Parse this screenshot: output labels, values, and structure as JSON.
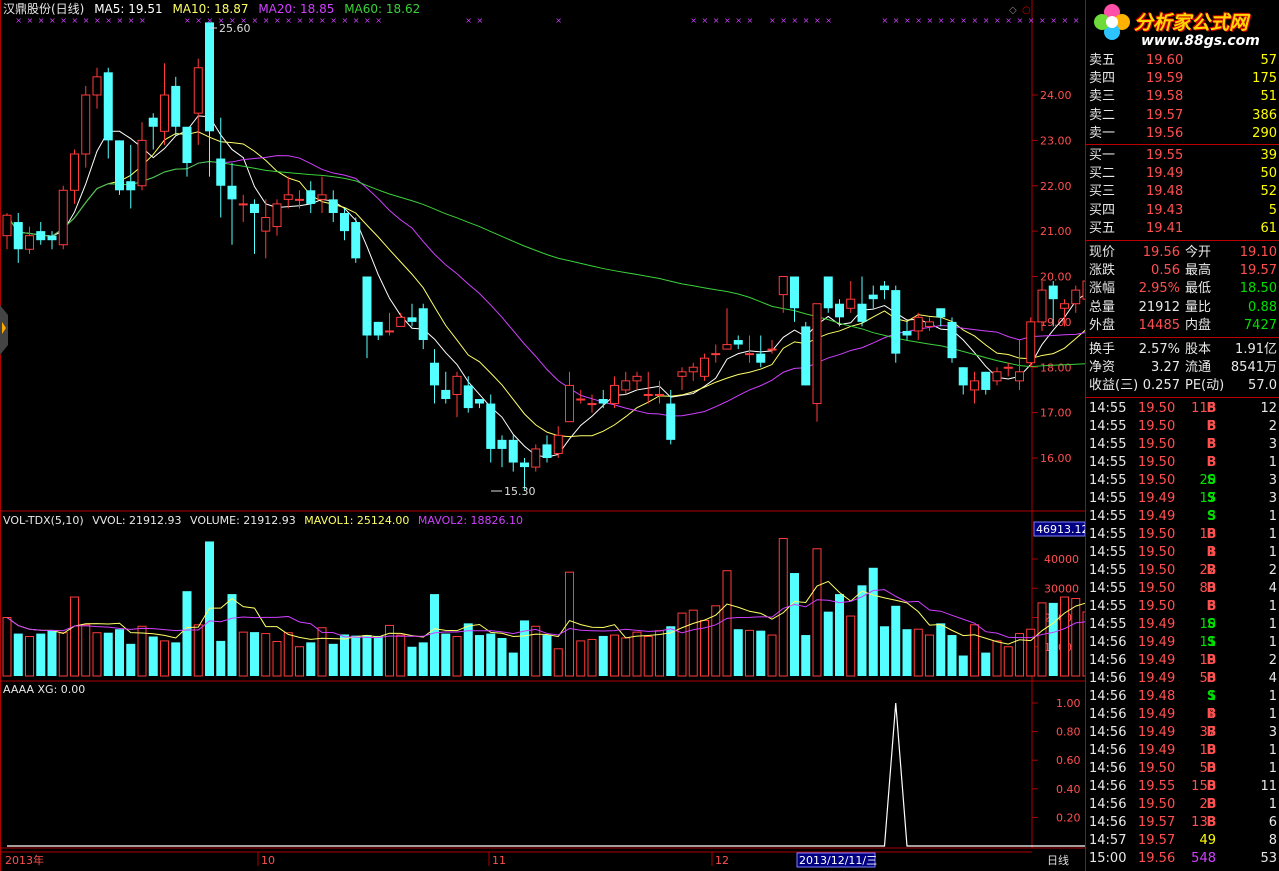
{
  "header": {
    "title": "汉鼎股份(日线)",
    "ma5": "MA5: 19.51",
    "ma10": "MA10: 18.87",
    "ma20": "MA20: 18.85",
    "ma60": "MA60: 18.62",
    "high_label": "25.60",
    "low_label": "15.30"
  },
  "vol_header": {
    "name": "VOL-TDX(5,10)",
    "vvol": "VVOL: 21912.93",
    "volume": "VOLUME: 21912.93",
    "mavol1": "MAVOL1: 25124.00",
    "mavol2": "MAVOL2: 18826.10",
    "max_box": "46913.12"
  },
  "ind_header": {
    "text": "AAAA XG: 0.00"
  },
  "axis": {
    "price_ticks": [
      "24.00",
      "23.00",
      "22.00",
      "21.00",
      "20.00",
      "19.00",
      "18.00",
      "17.00",
      "16.00"
    ],
    "vol_ticks": [
      "40000",
      "30000",
      "20000",
      "10000"
    ],
    "ind_ticks": [
      "1.00",
      "0.80",
      "0.60",
      "0.40",
      "0.20"
    ],
    "date_labels": [
      "2013年",
      "10",
      "11",
      "12"
    ],
    "cursor_date": "2013/12/11/三",
    "period": "日线"
  },
  "colors": {
    "up": "#ff3b3b",
    "down": "#54ffff",
    "ma5": "#ffffff",
    "ma10": "#ffff66",
    "ma20": "#d040ff",
    "ma60": "#3bd13b",
    "frame": "#b00000"
  },
  "chart_data": [
    {
      "type": "candlestick",
      "title": "汉鼎股份(日线)",
      "ylim": [
        15.0,
        25.8
      ],
      "candles": [
        [
          20.9,
          21.35,
          21.4,
          20.6
        ],
        [
          21.2,
          20.6,
          21.4,
          20.3
        ],
        [
          20.6,
          20.9,
          21.1,
          20.5
        ],
        [
          21.0,
          20.8,
          21.2,
          20.7
        ],
        [
          20.9,
          20.8,
          21.0,
          20.6
        ],
        [
          20.7,
          21.9,
          22.0,
          20.6
        ],
        [
          21.9,
          22.7,
          22.8,
          21.6
        ],
        [
          22.7,
          24.0,
          24.2,
          22.4
        ],
        [
          24.0,
          24.4,
          24.6,
          23.7
        ],
        [
          24.5,
          23.0,
          24.6,
          22.6
        ],
        [
          23.0,
          21.9,
          23.0,
          21.8
        ],
        [
          22.1,
          21.9,
          22.9,
          21.5
        ],
        [
          22.0,
          23.0,
          23.4,
          21.9
        ],
        [
          23.5,
          23.3,
          23.6,
          22.8
        ],
        [
          23.2,
          24.0,
          24.7,
          22.9
        ],
        [
          24.2,
          23.3,
          24.4,
          23.1
        ],
        [
          23.3,
          22.5,
          23.2,
          22.2
        ],
        [
          23.6,
          24.6,
          24.8,
          22.9
        ],
        [
          25.6,
          23.2,
          25.6,
          22.2
        ],
        [
          22.6,
          22.0,
          23.5,
          21.3
        ],
        [
          22.0,
          21.7,
          22.5,
          20.7
        ],
        [
          21.6,
          21.6,
          21.8,
          21.2
        ],
        [
          21.6,
          21.4,
          21.7,
          20.5
        ],
        [
          21.0,
          21.3,
          21.7,
          20.4
        ],
        [
          21.1,
          21.6,
          21.7,
          20.9
        ],
        [
          21.7,
          21.8,
          22.2,
          21.5
        ],
        [
          21.7,
          21.7,
          21.9,
          21.5
        ],
        [
          21.9,
          21.6,
          22.1,
          21.4
        ],
        [
          21.7,
          21.8,
          22.2,
          21.4
        ],
        [
          21.7,
          21.4,
          21.9,
          21.2
        ],
        [
          21.4,
          21.0,
          21.5,
          20.8
        ],
        [
          21.2,
          20.4,
          21.3,
          20.3
        ],
        [
          20.0,
          18.7,
          20.0,
          18.2
        ],
        [
          19.0,
          18.7,
          19.0,
          18.6
        ],
        [
          18.8,
          18.8,
          19.2,
          18.7
        ],
        [
          18.9,
          19.1,
          19.2,
          18.9
        ],
        [
          19.1,
          19.0,
          19.4,
          18.9
        ],
        [
          19.3,
          18.6,
          19.4,
          18.4
        ],
        [
          18.1,
          17.6,
          18.4,
          17.2
        ],
        [
          17.5,
          17.3,
          17.9,
          17.2
        ],
        [
          17.4,
          17.8,
          17.9,
          16.9
        ],
        [
          17.6,
          17.1,
          17.8,
          17.0
        ],
        [
          17.3,
          17.2,
          17.3,
          17.1
        ],
        [
          17.2,
          16.2,
          17.4,
          15.9
        ],
        [
          16.4,
          16.2,
          16.5,
          15.8
        ],
        [
          16.4,
          15.9,
          16.5,
          15.7
        ],
        [
          15.9,
          15.8,
          16.0,
          15.3
        ],
        [
          15.8,
          16.2,
          16.3,
          15.7
        ],
        [
          16.3,
          16.0,
          16.5,
          15.9
        ],
        [
          16.1,
          16.5,
          16.7,
          16.0
        ],
        [
          16.8,
          17.6,
          17.9,
          16.9
        ],
        [
          17.3,
          17.3,
          17.5,
          17.2
        ],
        [
          17.2,
          17.2,
          17.4,
          17.0
        ],
        [
          17.3,
          17.2,
          17.5,
          17.1
        ],
        [
          17.2,
          17.6,
          17.8,
          17.1
        ],
        [
          17.5,
          17.7,
          17.9,
          17.4
        ],
        [
          17.7,
          17.8,
          17.9,
          17.5
        ],
        [
          17.4,
          17.4,
          17.9,
          17.2
        ],
        [
          17.4,
          17.4,
          17.7,
          17.2
        ],
        [
          17.2,
          16.4,
          17.5,
          16.3
        ],
        [
          17.8,
          17.9,
          18.0,
          17.5
        ],
        [
          17.9,
          18.0,
          18.1,
          17.7
        ],
        [
          17.8,
          18.2,
          18.3,
          17.7
        ],
        [
          18.3,
          18.3,
          18.5,
          18.1
        ],
        [
          18.4,
          18.5,
          19.3,
          18.4
        ],
        [
          18.6,
          18.5,
          18.7,
          18.4
        ],
        [
          18.3,
          18.3,
          18.7,
          18.1
        ],
        [
          18.3,
          18.1,
          18.7,
          18.0
        ],
        [
          18.4,
          18.4,
          18.6,
          18.3
        ],
        [
          19.6,
          20.0,
          20.0,
          19.2
        ],
        [
          20.0,
          19.3,
          20.0,
          19.0
        ],
        [
          18.9,
          17.6,
          19.0,
          17.6
        ],
        [
          17.2,
          19.4,
          19.4,
          16.8
        ],
        [
          20.0,
          19.3,
          20.0,
          19.2
        ],
        [
          19.4,
          19.1,
          19.5,
          18.9
        ],
        [
          19.3,
          19.5,
          19.9,
          19.2
        ],
        [
          19.4,
          19.0,
          20.0,
          18.9
        ],
        [
          19.6,
          19.5,
          19.8,
          19.3
        ],
        [
          19.8,
          19.7,
          19.9,
          19.5
        ],
        [
          19.7,
          18.3,
          19.8,
          18.1
        ],
        [
          18.8,
          18.7,
          19.0,
          18.6
        ],
        [
          18.8,
          19.1,
          19.2,
          18.6
        ],
        [
          18.9,
          19.0,
          19.1,
          18.8
        ],
        [
          19.3,
          19.1,
          19.3,
          18.9
        ],
        [
          19.0,
          18.2,
          19.1,
          18.1
        ],
        [
          18.0,
          17.6,
          18.0,
          17.4
        ],
        [
          17.5,
          17.7,
          17.9,
          17.2
        ],
        [
          17.9,
          17.5,
          17.9,
          17.4
        ],
        [
          17.7,
          17.9,
          18.0,
          17.6
        ],
        [
          18.0,
          18.0,
          18.1,
          17.8
        ],
        [
          17.7,
          17.9,
          18.6,
          17.5
        ],
        [
          18.1,
          19.0,
          19.1,
          18.0
        ],
        [
          19.0,
          19.7,
          19.9,
          18.8
        ],
        [
          19.8,
          19.5,
          19.9,
          18.9
        ],
        [
          19.3,
          19.4,
          19.5,
          18.9
        ],
        [
          19.4,
          19.7,
          19.8,
          19.2
        ],
        [
          19.5,
          19.9,
          20.1,
          19.2
        ],
        [
          20.0,
          19.0,
          20.1,
          18.9
        ],
        [
          18.9,
          19.56,
          19.6,
          18.5
        ]
      ],
      "ma_lines": {
        "ma5": "MA5: 19.51",
        "ma10": "MA10: 18.87",
        "ma20": "MA20: 18.85",
        "ma60": "MA60: 18.62"
      }
    },
    {
      "type": "bar",
      "title": "VOL-TDX(5,10)",
      "ylim": [
        0,
        50000
      ],
      "volumes": [
        20000,
        14500,
        13500,
        14500,
        15500,
        14800,
        27000,
        17500,
        14800,
        14800,
        16000,
        11000,
        17000,
        13500,
        12000,
        11500,
        29000,
        17500,
        46000,
        12000,
        28000,
        15000,
        15000,
        14500,
        11800,
        14800,
        10000,
        11500,
        16500,
        11000,
        14200,
        13800,
        14000,
        13700,
        17300,
        14000,
        10000,
        11500,
        28000,
        14500,
        13500,
        18000,
        14000,
        14500,
        13000,
        8000,
        19000,
        17000,
        14000,
        9300,
        35500,
        12000,
        12500,
        13700,
        14000,
        13000,
        15000,
        13500,
        15500,
        17000,
        21500,
        22500,
        19000,
        24000,
        36000,
        16000,
        15600,
        15500,
        14000,
        47000,
        35200,
        14000,
        43500,
        22000,
        28000,
        20500,
        31000,
        37000,
        17000,
        24000,
        16000,
        16000,
        14000,
        18000,
        14000,
        7000,
        17500,
        8000,
        12000,
        10000,
        14500,
        16000,
        25000,
        25000,
        27000,
        26500,
        21913
      ],
      "mavol1": "MAVOL1: 25124.00",
      "mavol2": "MAVOL2: 18826.10"
    },
    {
      "type": "line",
      "title": "AAAA XG",
      "ylim": [
        0,
        1.1
      ],
      "spike_index": 79,
      "value": "AAAA XG: 0.00"
    }
  ],
  "quote": {
    "sell": [
      {
        "label": "卖五",
        "price": "19.60",
        "vol": "57"
      },
      {
        "label": "卖四",
        "price": "19.59",
        "vol": "175"
      },
      {
        "label": "卖三",
        "price": "19.58",
        "vol": "51"
      },
      {
        "label": "卖二",
        "price": "19.57",
        "vol": "386"
      },
      {
        "label": "卖一",
        "price": "19.56",
        "vol": "290"
      }
    ],
    "buy": [
      {
        "label": "买一",
        "price": "19.55",
        "vol": "39"
      },
      {
        "label": "买二",
        "price": "19.49",
        "vol": "50"
      },
      {
        "label": "买三",
        "price": "19.48",
        "vol": "52"
      },
      {
        "label": "买四",
        "price": "19.43",
        "vol": "5"
      },
      {
        "label": "买五",
        "price": "19.41",
        "vol": "61"
      }
    ],
    "stats": [
      {
        "l1": "现价",
        "v1": "19.56",
        "c1": "c-red",
        "l2": "今开",
        "v2": "19.10",
        "c2": "c-red"
      },
      {
        "l1": "涨跌",
        "v1": "0.56",
        "c1": "c-red",
        "l2": "最高",
        "v2": "19.57",
        "c2": "c-red"
      },
      {
        "l1": "涨幅",
        "v1": "2.95%",
        "c1": "c-red",
        "l2": "最低",
        "v2": "18.50",
        "c2": "c-grn"
      },
      {
        "l1": "总量",
        "v1": "21912",
        "c1": "c-wht",
        "l2": "量比",
        "v2": "0.88",
        "c2": "c-grn"
      },
      {
        "l1": "外盘",
        "v1": "14485",
        "c1": "c-red",
        "l2": "内盘",
        "v2": "7427",
        "c2": "c-grn"
      }
    ],
    "stats2": [
      {
        "l1": "换手",
        "v1": "2.57%",
        "l2": "股本",
        "v2": "1.91亿"
      },
      {
        "l1": "净资",
        "v1": "3.27",
        "l2": "流通",
        "v2": "8541万"
      },
      {
        "l1": "收益(三)",
        "v1": "0.257",
        "l2": "PE(动)",
        "v2": "57.0"
      }
    ]
  },
  "trades": [
    [
      "14:55",
      "19.50",
      "115",
      "B",
      "12"
    ],
    [
      "14:55",
      "19.50",
      "5",
      "B",
      "2"
    ],
    [
      "14:55",
      "19.50",
      "5",
      "B",
      "3"
    ],
    [
      "14:55",
      "19.50",
      "3",
      "B",
      "1"
    ],
    [
      "14:55",
      "19.50",
      "20",
      "S",
      "3"
    ],
    [
      "14:55",
      "19.49",
      "17",
      "S",
      "3"
    ],
    [
      "14:55",
      "19.49",
      "3",
      "S",
      "1"
    ],
    [
      "14:55",
      "19.50",
      "10",
      "B",
      "1"
    ],
    [
      "14:55",
      "19.50",
      "1",
      "B",
      "1"
    ],
    [
      "14:55",
      "19.50",
      "22",
      "B",
      "2"
    ],
    [
      "14:55",
      "19.50",
      "80",
      "B",
      "4"
    ],
    [
      "14:55",
      "19.50",
      "6",
      "B",
      "1"
    ],
    [
      "14:55",
      "19.49",
      "10",
      "S",
      "1"
    ],
    [
      "14:56",
      "19.49",
      "11",
      "S",
      "1"
    ],
    [
      "14:56",
      "19.49",
      "19",
      "B",
      "2"
    ],
    [
      "14:56",
      "19.49",
      "50",
      "B",
      "4"
    ],
    [
      "14:56",
      "19.48",
      "1",
      "S",
      "1"
    ],
    [
      "14:56",
      "19.49",
      "4",
      "B",
      "1"
    ],
    [
      "14:56",
      "19.49",
      "37",
      "B",
      "3"
    ],
    [
      "14:56",
      "19.49",
      "10",
      "B",
      "1"
    ],
    [
      "14:56",
      "19.50",
      "50",
      "B",
      "1"
    ],
    [
      "14:56",
      "19.55",
      "150",
      "B",
      "11"
    ],
    [
      "14:56",
      "19.50",
      "20",
      "B",
      "1"
    ],
    [
      "14:56",
      "19.57",
      "133",
      "B",
      "6"
    ],
    [
      "14:57",
      "19.57",
      "49",
      "",
      "8"
    ],
    [
      "15:00",
      "19.56",
      "548",
      "",
      "53"
    ]
  ],
  "logo": {
    "text": "分析家公式网",
    "url_text": "www.88gs.com"
  }
}
